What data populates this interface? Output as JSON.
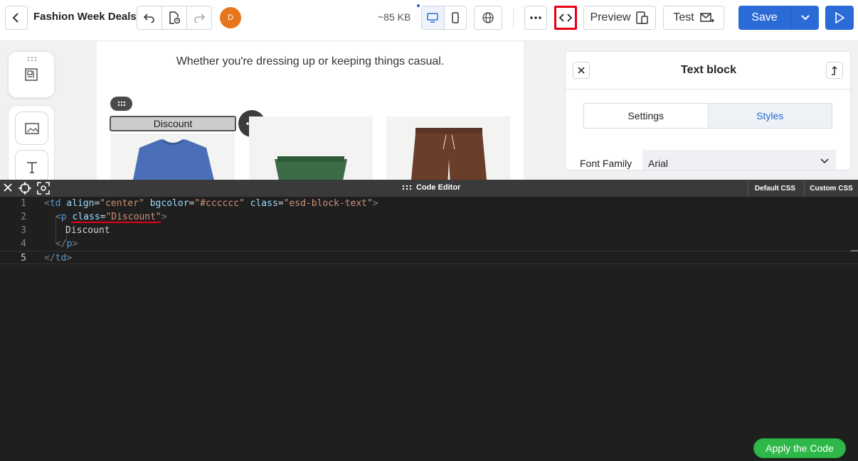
{
  "header": {
    "title": "Fashion Week Deals",
    "avatar_initial": "D",
    "size": "~85 KB",
    "preview_label": "Preview",
    "test_label": "Test",
    "save_label": "Save",
    "accent_color": "#2b6bd8"
  },
  "canvas": {
    "text": "Whether you're dressing up or keeping things casual.",
    "selected_block_text": "Discount",
    "products": [
      "blue-tshirt",
      "green-shorts",
      "brown-shorts"
    ]
  },
  "panel": {
    "title": "Text block",
    "tabs": [
      {
        "label": "Settings",
        "active": false
      },
      {
        "label": "Styles",
        "active": true
      }
    ],
    "font_family_label": "Font Family",
    "font_family_value": "Arial"
  },
  "editor": {
    "title": "Code Editor",
    "tabs": [
      "Default CSS",
      "Custom CSS"
    ],
    "line_numbers": [
      "1",
      "2",
      "3",
      "4",
      "5"
    ],
    "lines": [
      {
        "tag_open": "<",
        "tag": "td",
        "a1": "align",
        "v1": "\"center\"",
        "a2": "bgcolor",
        "v2": "\"#cccccc\"",
        "a3": "class",
        "v3": "\"esd-block-text\"",
        "close": ">"
      },
      {
        "tag_open": "<",
        "tag": "p",
        "a1": "class",
        "v1": "\"Discount\"",
        "close": ">"
      },
      {
        "text": "Discount"
      },
      {
        "tag_open": "</",
        "tag": "p",
        "close": ">"
      },
      {
        "tag_open": "</",
        "tag": "td",
        "close": ">"
      }
    ],
    "apply_label": "Apply the Code"
  }
}
